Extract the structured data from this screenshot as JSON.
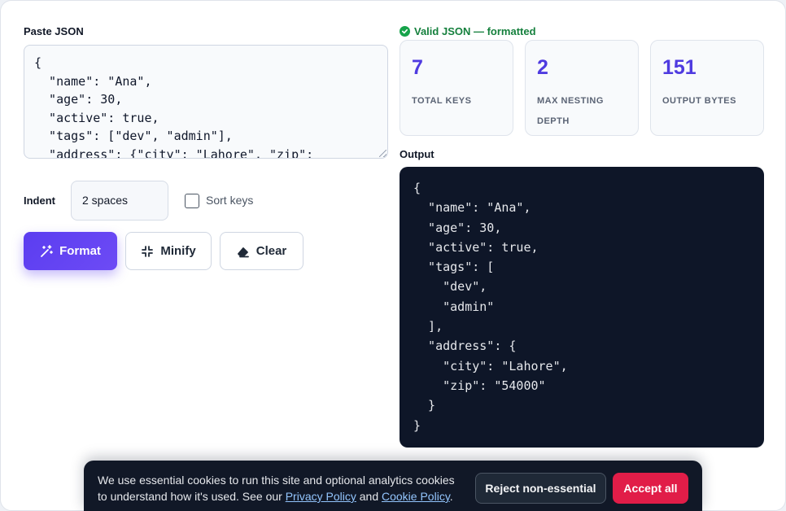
{
  "input": {
    "label": "Paste JSON",
    "value": "{\n  \"name\": \"Ana\",\n  \"age\": 30,\n  \"active\": true,\n  \"tags\": [\"dev\", \"admin\"],\n  \"address\": {\"city\": \"Lahore\", \"zip\":"
  },
  "controls": {
    "indent_label": "Indent",
    "indent_value": "2 spaces",
    "sort_keys_label": "Sort keys",
    "sort_keys_checked": false
  },
  "buttons": {
    "format": "Format",
    "minify": "Minify",
    "clear": "Clear"
  },
  "status": {
    "text": "Valid JSON — formatted",
    "color": "#15803d"
  },
  "stats": [
    {
      "value": "7",
      "label": "TOTAL KEYS"
    },
    {
      "value": "2",
      "label": "MAX NESTING DEPTH"
    },
    {
      "value": "151",
      "label": "OUTPUT BYTES"
    }
  ],
  "output": {
    "label": "Output",
    "value": "{\n  \"name\": \"Ana\",\n  \"age\": 30,\n  \"active\": true,\n  \"tags\": [\n    \"dev\",\n    \"admin\"\n  ],\n  \"address\": {\n    \"city\": \"Lahore\",\n    \"zip\": \"54000\"\n  }\n}"
  },
  "cookie": {
    "text_before": "We use essential cookies to run this site and optional analytics cookies to understand how it's used. See our ",
    "privacy_link": "Privacy Policy",
    "text_middle": " and ",
    "cookie_link": "Cookie Policy",
    "text_after": ".",
    "reject": "Reject non-essential",
    "accept": "Accept all"
  },
  "icons": {
    "format": "magic-wand-icon",
    "minify": "collapse-arrows-icon",
    "clear": "eraser-icon",
    "valid": "check-circle-icon"
  },
  "colors": {
    "accent": "#5b3df0",
    "stat_value": "#4f3be0",
    "output_bg": "#0e1628",
    "accept": "#e11d48"
  }
}
